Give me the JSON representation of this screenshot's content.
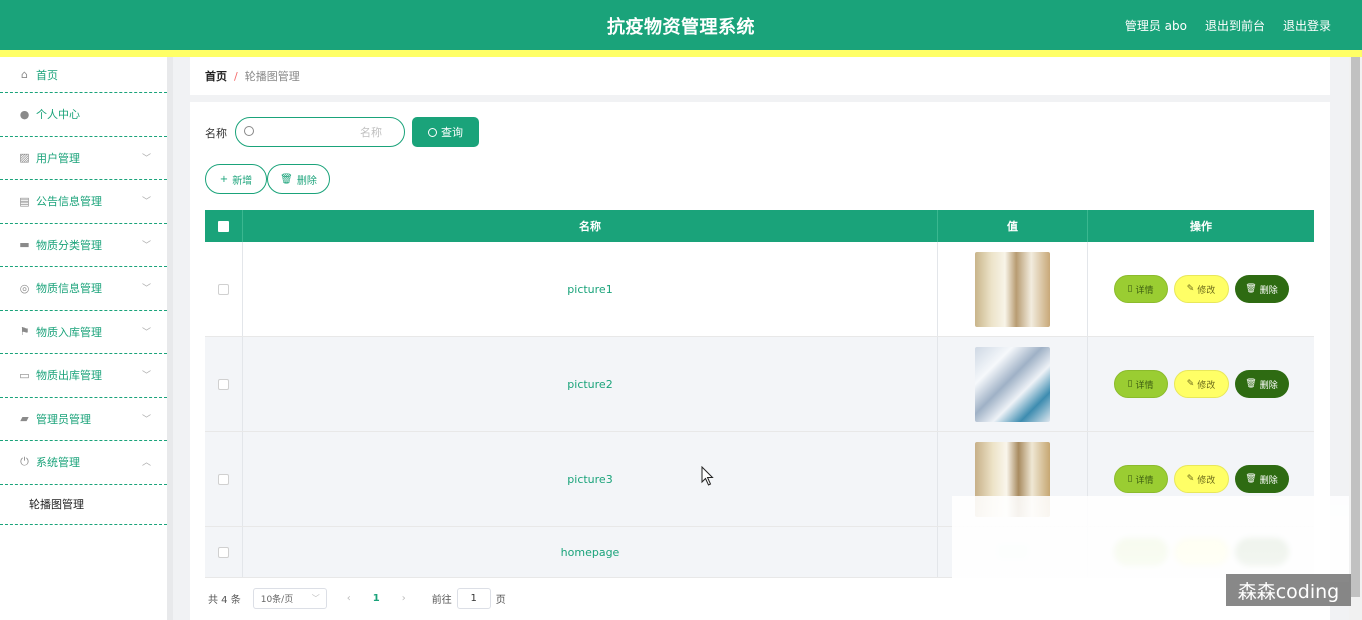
{
  "header": {
    "title": "抗疫物资管理系统",
    "user": "管理员 abo",
    "to_front": "退出到前台",
    "logout": "退出登录"
  },
  "sidebar": {
    "items": [
      {
        "label": "首页",
        "icon": "home-icon"
      },
      {
        "label": "个人中心",
        "icon": "user-icon"
      },
      {
        "label": "用户管理",
        "icon": "chart-icon"
      },
      {
        "label": "公告信息管理",
        "icon": "clipboard-icon"
      },
      {
        "label": "物质分类管理",
        "icon": "briefcase-icon"
      },
      {
        "label": "物质信息管理",
        "icon": "compass-icon"
      },
      {
        "label": "物质入库管理",
        "icon": "flag-icon"
      },
      {
        "label": "物质出库管理",
        "icon": "message-icon"
      },
      {
        "label": "管理员管理",
        "icon": "wallet-icon"
      },
      {
        "label": "系统管理",
        "icon": "power-icon"
      }
    ],
    "sub_item": "轮播图管理"
  },
  "breadcrumb": {
    "home": "首页",
    "sep": "/",
    "current": "轮播图管理"
  },
  "search": {
    "label": "名称",
    "placeholder": "名称",
    "query_button": "查询"
  },
  "actions": {
    "add": "新增",
    "delete": "删除"
  },
  "table": {
    "headers": [
      "名称",
      "值",
      "操作"
    ],
    "rows": [
      {
        "name": "picture1"
      },
      {
        "name": "picture2"
      },
      {
        "name": "picture3"
      },
      {
        "name": "homepage"
      }
    ],
    "ops": {
      "detail": "详情",
      "edit": "修改",
      "delete": "删除"
    }
  },
  "pagination": {
    "total": "共 4 条",
    "page_size": "10条/页",
    "prev": "‹",
    "current_page": "1",
    "next": "›",
    "goto": "前往",
    "goto_value": "1",
    "page_unit": "页"
  },
  "watermark": "森森coding",
  "colors": {
    "primary": "#1aa37a",
    "stripe": "#ffff66",
    "detail_btn": "#9acd32",
    "edit_btn": "#ffff66",
    "delete_btn": "#2e6b12"
  }
}
